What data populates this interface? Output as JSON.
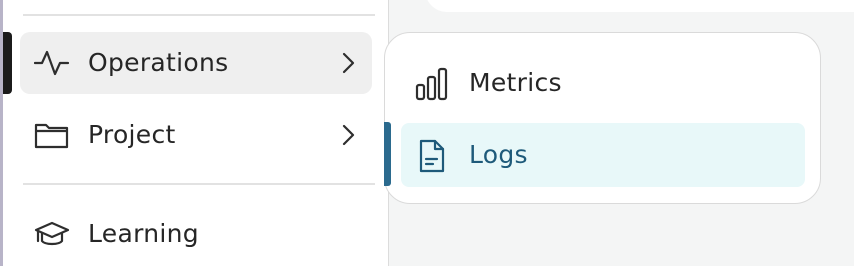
{
  "sidebar": {
    "items": [
      {
        "label": "Operations",
        "icon": "activity-icon",
        "has_submenu": true,
        "state": "hovered-active"
      },
      {
        "label": "Project",
        "icon": "folder-icon",
        "has_submenu": true
      },
      {
        "label": "Learning",
        "icon": "graduation-cap-icon",
        "has_submenu": false
      }
    ]
  },
  "flyout": {
    "items": [
      {
        "label": "Metrics",
        "icon": "bar-chart-icon"
      },
      {
        "label": "Logs",
        "icon": "document-icon",
        "selected": true
      }
    ]
  },
  "colors": {
    "active_indicator": "#1b1b1b",
    "selected_bg": "#e8f8f9",
    "selected_text": "#1e5a7a",
    "selected_indicator": "#2b6a8e"
  }
}
